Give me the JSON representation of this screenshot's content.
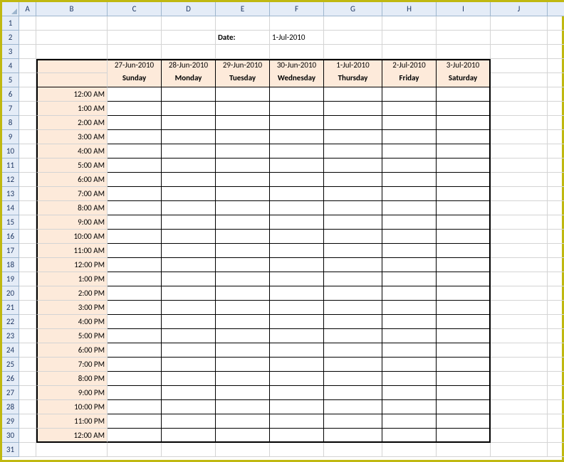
{
  "columns": [
    "A",
    "B",
    "C",
    "D",
    "E",
    "F",
    "G",
    "H",
    "I",
    "J"
  ],
  "dateLabel": "Date:",
  "dateValue": "1-Jul-2010",
  "days": [
    {
      "date": "27-Jun-2010",
      "name": "Sunday"
    },
    {
      "date": "28-Jun-2010",
      "name": "Monday"
    },
    {
      "date": "29-Jun-2010",
      "name": "Tuesday"
    },
    {
      "date": "30-Jun-2010",
      "name": "Wednesday"
    },
    {
      "date": "1-Jul-2010",
      "name": "Thursday"
    },
    {
      "date": "2-Jul-2010",
      "name": "Friday"
    },
    {
      "date": "3-Jul-2010",
      "name": "Saturday"
    }
  ],
  "times": [
    "12:00 AM",
    "1:00 AM",
    "2:00 AM",
    "3:00 AM",
    "4:00 AM",
    "5:00 AM",
    "6:00 AM",
    "7:00 AM",
    "8:00 AM",
    "9:00 AM",
    "10:00 AM",
    "11:00 AM",
    "12:00 PM",
    "1:00 PM",
    "2:00 PM",
    "3:00 PM",
    "4:00 PM",
    "5:00 PM",
    "6:00 PM",
    "7:00 PM",
    "8:00 PM",
    "9:00 PM",
    "10:00 PM",
    "11:00 PM",
    "12:00 AM"
  ],
  "rowCount": 31
}
